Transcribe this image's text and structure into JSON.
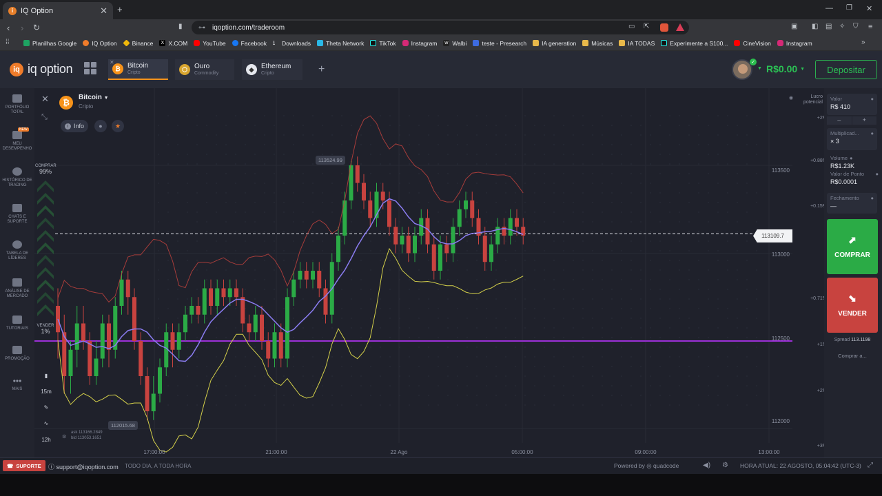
{
  "browser": {
    "tab_title": "IQ Option",
    "url": "iqoption.com/traderoom",
    "bookmarks": [
      "Planilhas Google",
      "IQ Option",
      "Binance",
      "X.COM",
      "YouTube",
      "Facebook",
      "Downloads",
      "Theta Network",
      "TikTok",
      "Instagram",
      "Walbi",
      "teste - Presearch",
      "IA generation",
      "Músicas",
      "IA TODAS",
      "Experimente a S100...",
      "CineVision",
      "Instagram"
    ]
  },
  "header": {
    "logo": "iq option",
    "tabs": [
      {
        "name": "Bitcoin",
        "sub": "Cripto"
      },
      {
        "name": "Ouro",
        "sub": "Commodity"
      },
      {
        "name": "Ethereum",
        "sub": "Cripto"
      }
    ],
    "balance": "R$0.00",
    "deposit": "Depositar"
  },
  "sidebar": {
    "items": [
      {
        "label": "PORTFÓLIO TOTAL"
      },
      {
        "label": "MEU DESEMPENHO"
      },
      {
        "label": "HISTÓRICO DE TRADING"
      },
      {
        "label": "CHATS E SUPORTE"
      },
      {
        "label": "TABELA DE LÍDERES"
      },
      {
        "label": "ANÁLISE DE MERCADO"
      },
      {
        "label": "TUTORIAIS"
      },
      {
        "label": "PROMOÇÃO"
      },
      {
        "label": "MAIS"
      }
    ],
    "new_badge": "NEW"
  },
  "asset": {
    "name": "Bitcoin",
    "sub": "Cripto",
    "info": "Info"
  },
  "sentiment": {
    "buy_label": "COMPRAR",
    "buy_pct": "99%",
    "sell_label": "VENDER",
    "sell_pct": "1%"
  },
  "tools": {
    "timeframe": "15m",
    "range": "12h"
  },
  "chart": {
    "high_label": "113524.99",
    "low_label": "112015.68",
    "current_price": "113109.7",
    "ask": "ask 113166.2849",
    "bid": "bid 113053.1651",
    "y_labels": [
      "113500",
      "113000",
      "112500",
      "112000"
    ],
    "pct_labels": [
      "+2%",
      "+0.88%",
      "+0.15%",
      "+0.71%",
      "+1%",
      "+2%",
      "+3%"
    ],
    "x_labels": [
      "17:00:00",
      "21:00:00",
      "22 Ago",
      "05:00:00",
      "09:00:00",
      "13:00:00"
    ],
    "lucro": "Lucro potencial"
  },
  "chart_data": {
    "type": "candlestick",
    "ylim": [
      111900,
      113900
    ],
    "candles": [
      [
        112700,
        112550,
        112800,
        112400
      ],
      [
        112550,
        112300,
        112650,
        112200
      ],
      [
        112300,
        112450,
        112500,
        112200
      ],
      [
        112450,
        112600,
        112700,
        112350
      ],
      [
        112600,
        112500,
        112700,
        112450
      ],
      [
        112500,
        112300,
        112550,
        112250
      ],
      [
        112300,
        112400,
        112500,
        112250
      ],
      [
        112400,
        112600,
        112650,
        112350
      ],
      [
        112600,
        112450,
        112650,
        112350
      ],
      [
        112450,
        112700,
        112750,
        112400
      ],
      [
        112700,
        112850,
        112900,
        112650
      ],
      [
        112850,
        112750,
        112900,
        112650
      ],
      [
        112750,
        112500,
        112800,
        112450
      ],
      [
        112500,
        112300,
        112550,
        112250
      ],
      [
        112300,
        112100,
        112350,
        112050
      ],
      [
        112100,
        112200,
        112300,
        112050
      ],
      [
        112200,
        112350,
        112400,
        112150
      ],
      [
        112350,
        112550,
        112600,
        112300
      ],
      [
        112550,
        112450,
        112600,
        112350
      ],
      [
        112450,
        112550,
        112600,
        112400
      ],
      [
        112550,
        112650,
        112700,
        112500
      ],
      [
        112650,
        112700,
        112750,
        112600
      ],
      [
        112700,
        112650,
        112750,
        112600
      ],
      [
        112650,
        112800,
        112850,
        112600
      ],
      [
        112800,
        112700,
        112850,
        112650
      ],
      [
        112700,
        112800,
        112850,
        112650
      ],
      [
        112800,
        112750,
        112850,
        112700
      ],
      [
        112750,
        112800,
        112850,
        112700
      ],
      [
        112800,
        112750,
        112850,
        112700
      ],
      [
        112750,
        112600,
        112800,
        112550
      ],
      [
        112600,
        112550,
        112650,
        112500
      ],
      [
        112550,
        112650,
        112700,
        112500
      ],
      [
        112650,
        112500,
        112700,
        112450
      ],
      [
        112500,
        112400,
        112550,
        112350
      ],
      [
        112400,
        112550,
        112600,
        112350
      ],
      [
        112550,
        112400,
        112600,
        112350
      ],
      [
        112400,
        112750,
        112800,
        112350
      ],
      [
        112750,
        112850,
        112900,
        112700
      ],
      [
        112850,
        112900,
        112950,
        112800
      ],
      [
        112900,
        112850,
        112950,
        112800
      ],
      [
        112850,
        112900,
        112950,
        112800
      ],
      [
        112900,
        112800,
        112950,
        112750
      ],
      [
        112800,
        112650,
        112850,
        112600
      ],
      [
        112650,
        112950,
        113000,
        112600
      ],
      [
        112950,
        113100,
        113150,
        112900
      ],
      [
        113100,
        113300,
        113350,
        113050
      ],
      [
        113300,
        113500,
        113524,
        113250
      ],
      [
        113500,
        113400,
        113550,
        113350
      ],
      [
        113400,
        113300,
        113450,
        113250
      ],
      [
        113300,
        113200,
        113350,
        113150
      ],
      [
        113200,
        113350,
        113400,
        113150
      ],
      [
        113350,
        113300,
        113400,
        113250
      ],
      [
        113300,
        113150,
        113350,
        113100
      ],
      [
        113150,
        113050,
        113200,
        113000
      ],
      [
        113050,
        113100,
        113150,
        113000
      ],
      [
        113100,
        113000,
        113150,
        112950
      ],
      [
        113000,
        113100,
        113150,
        112950
      ],
      [
        113100,
        113200,
        113250,
        113050
      ],
      [
        113200,
        113050,
        113250,
        113000
      ],
      [
        113050,
        112900,
        113100,
        112850
      ],
      [
        112900,
        113050,
        113100,
        112850
      ],
      [
        113050,
        113000,
        113100,
        112950
      ],
      [
        113000,
        113150,
        113200,
        112950
      ],
      [
        113150,
        113250,
        113300,
        113100
      ],
      [
        113250,
        113300,
        113350,
        113200
      ],
      [
        113300,
        113200,
        113350,
        113150
      ],
      [
        113200,
        113100,
        113250,
        113050
      ],
      [
        113100,
        112950,
        113150,
        112900
      ],
      [
        112950,
        113050,
        113100,
        112900
      ],
      [
        113050,
        113150,
        113200,
        113000
      ],
      [
        113150,
        113100,
        113200,
        113050
      ],
      [
        113100,
        113200,
        113250,
        113050
      ],
      [
        113200,
        113150,
        113250,
        113100
      ],
      [
        113150,
        113100,
        113200,
        113050
      ]
    ],
    "levels": {
      "current": 113109.7,
      "purple": 112500
    }
  },
  "trade": {
    "valor_label": "Valor",
    "valor": "R$ 410",
    "mult_label": "Multiplicad...",
    "mult": "× 3",
    "volume_label": "Volume",
    "volume": "R$1.23K",
    "point_label": "Valor de Ponto",
    "point": "R$0.0001",
    "close_label": "Fechamento",
    "close": "—",
    "buy": "COMPRAR",
    "sell": "VENDER",
    "spread_label": "Spread",
    "spread": "113.1198",
    "buy_at": "Comprar a..."
  },
  "footer": {
    "support": "SUPORTE",
    "email": "support@iqoption.com",
    "hours": "TODO DIA, A TODA HORA",
    "powered": "Powered by ◎ quadcode",
    "time": "HORA ATUAL: 22 AGOSTO, 05:04:42 (UTC-3)"
  },
  "colors": {
    "accent": "#f07c2a",
    "buy": "#2bab46",
    "sell": "#c8433f",
    "purple": "#9b2fd6"
  }
}
